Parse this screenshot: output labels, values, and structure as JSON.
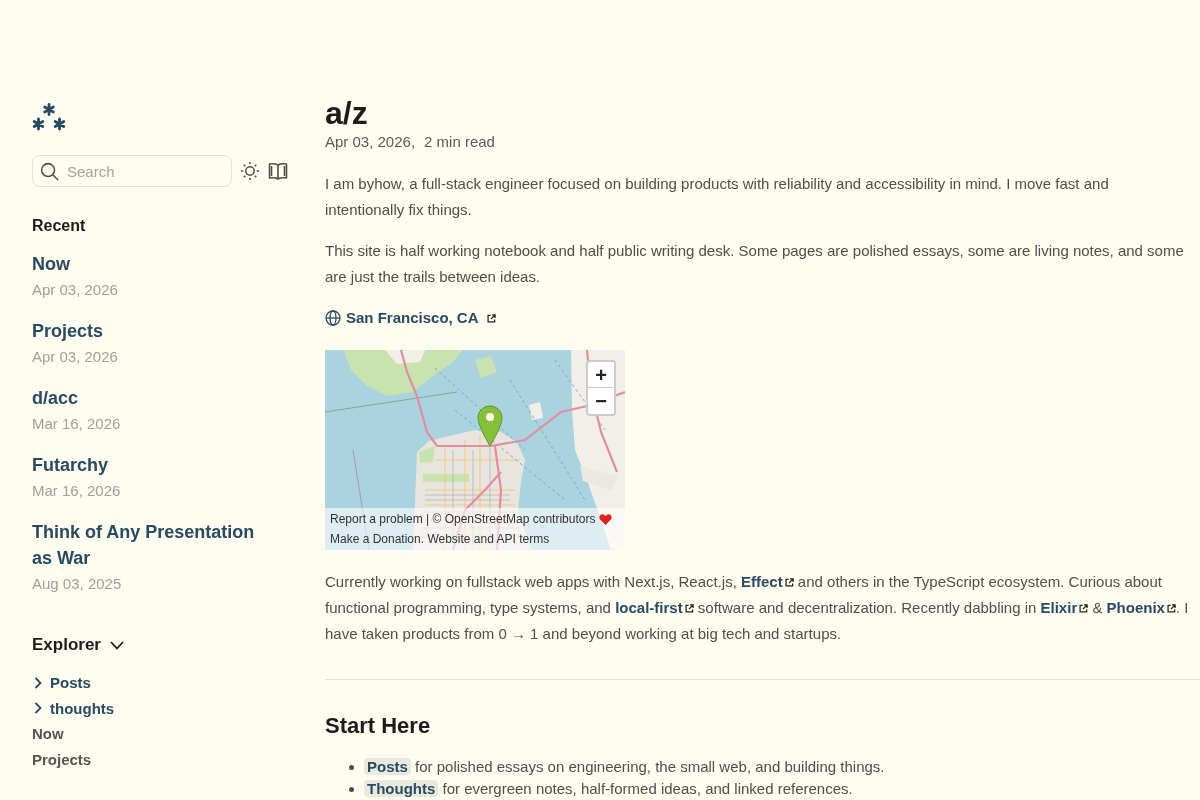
{
  "sidebar": {
    "search": {
      "placeholder": "Search"
    },
    "recent": {
      "title": "Recent",
      "items": [
        {
          "title": "Now",
          "date": "Apr 03, 2026"
        },
        {
          "title": "Projects",
          "date": "Apr 03, 2026"
        },
        {
          "title": "d/acc",
          "date": "Mar 16, 2026"
        },
        {
          "title": "Futarchy",
          "date": "Mar 16, 2026"
        },
        {
          "title": "Think of Any Presentation as War",
          "date": "Aug 03, 2025"
        }
      ]
    },
    "explorer": {
      "title": "Explorer",
      "expanded": true,
      "items": [
        {
          "kind": "folder",
          "label": "Posts",
          "expanded": false
        },
        {
          "kind": "folder",
          "label": "thoughts",
          "expanded": false
        },
        {
          "kind": "file",
          "label": "Now"
        },
        {
          "kind": "file",
          "label": "Projects"
        }
      ]
    }
  },
  "article": {
    "title": "a/z",
    "date": "Apr 03, 2026,",
    "reading_time": "2 min read",
    "intro": [
      "I am byhow, a full-stack engineer focused on building products with reliability and accessibility in mind. I move fast and intentionally fix things.",
      "This site is half working notebook and half public writing desk. Some pages are polished essays, some are living notes, and some are just the trails between ideas."
    ],
    "location": {
      "label": "San Francisco, CA"
    },
    "map": {
      "zoom_controls": [
        "+",
        "−"
      ],
      "attribution": [
        "Report a problem | © OpenStreetMap contributors",
        "Make a Donation. Website and API terms"
      ]
    },
    "bio": [
      {
        "kind": "text",
        "text": "Currently working on fullstack web apps with Next.js, React.js, "
      },
      {
        "kind": "external_link",
        "text": "Effect"
      },
      {
        "kind": "text",
        "text": " and others in the TypeScript ecosystem. Curious about functional programming, type systems, and "
      },
      {
        "kind": "external_link",
        "text": "local-first"
      },
      {
        "kind": "text",
        "text": " software and decentralization. Recently dabbling in "
      },
      {
        "kind": "external_link",
        "text": "Elixir"
      },
      {
        "kind": "text",
        "text": " & "
      },
      {
        "kind": "external_link",
        "text": "Phoenix"
      },
      {
        "kind": "text",
        "text": ". I have taken products from 0 → 1 and beyond working at big tech and startups."
      }
    ],
    "start_here": {
      "title": "Start Here",
      "items": [
        {
          "link": "Posts",
          "text": " for polished essays on engineering, the small web, and building things."
        },
        {
          "link": "Thoughts",
          "text": " for evergreen notes, half-formed ideas, and linked references."
        }
      ]
    }
  }
}
